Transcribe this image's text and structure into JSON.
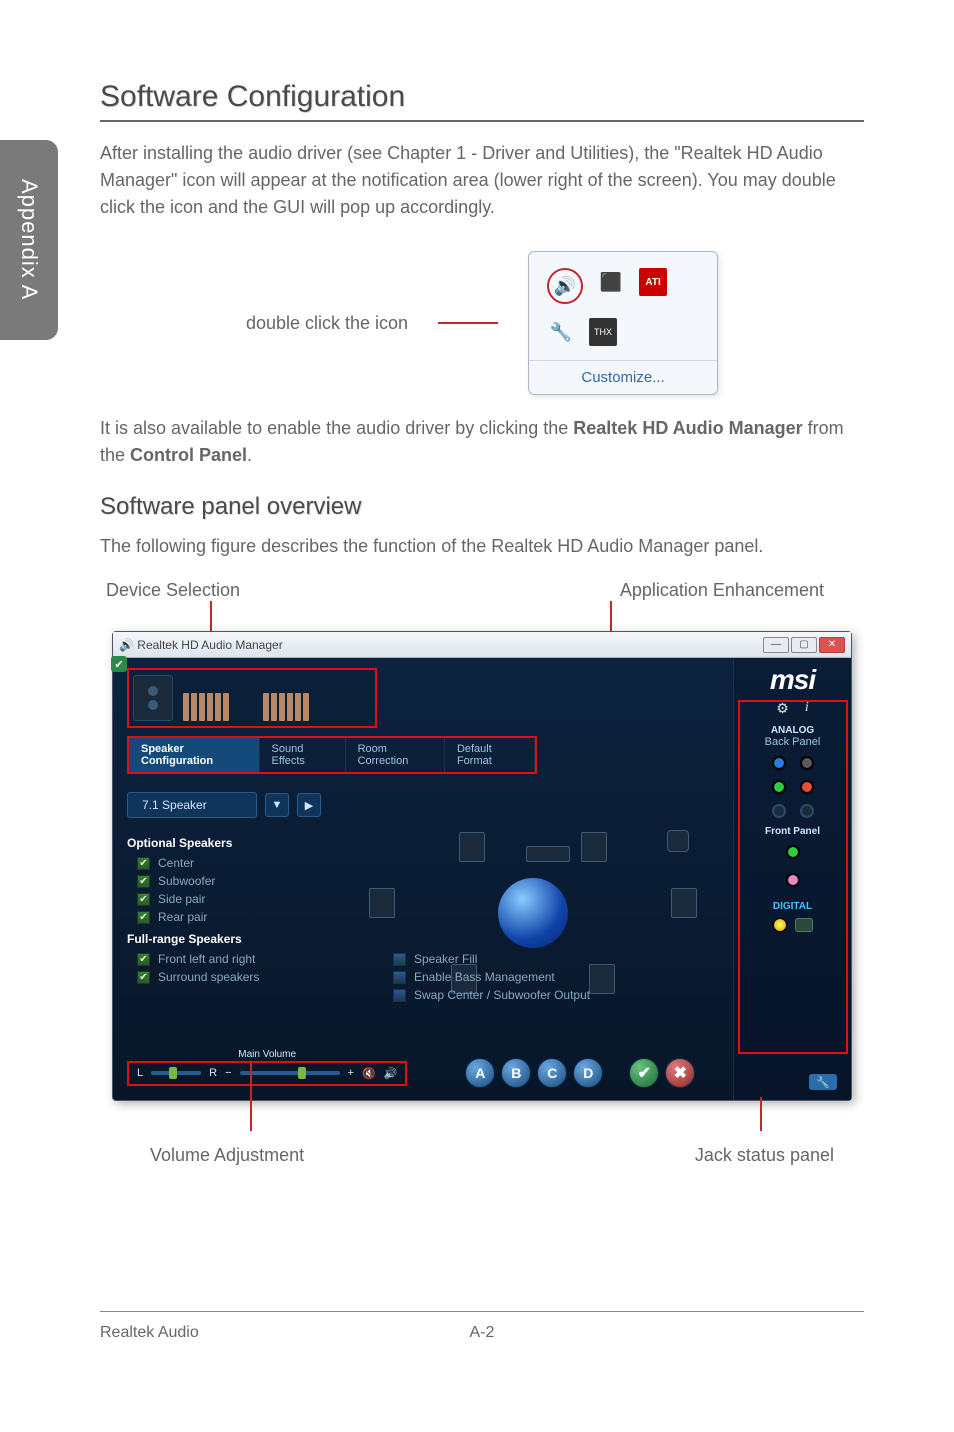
{
  "sideTab": "Appendix A",
  "title": "Software Configuration",
  "intro": "After installing the audio driver (see Chapter 1 - Driver and Utilities), the \"Realtek HD Audio Manager\" icon will appear at the notification area (lower right of the screen). You may double click the icon and the GUI will pop up accordingly.",
  "trayLabel": "double click the icon",
  "trayCustomize": "Customize...",
  "enableLine1": "It is also available to enable the audio driver by clicking the ",
  "enableBold1": "Realtek HD Audio Manager",
  "enableMid": " from the ",
  "enableBold2": "Control Panel",
  "enableEnd": ".",
  "subhead": "Software panel overview",
  "panelDesc": "The following figure describes the function of the Realtek HD Audio Manager panel.",
  "callouts": {
    "deviceSelection": "Device Selection",
    "appEnhancement": "Application Enhancement",
    "volumeAdjustment": "Volume Adjustment",
    "jackStatus": "Jack status panel"
  },
  "app": {
    "title": "Realtek HD Audio Manager",
    "logo": "msi",
    "tabs": {
      "speakerConfig": "Speaker Configuration",
      "soundEffects": "Sound Effects",
      "roomCorrection": "Room Correction",
      "defaultFormat": "Default Format"
    },
    "speakerSelect": "7.1 Speaker",
    "optSpeakersHead": "Optional Speakers",
    "optSpeakers": {
      "center": "Center",
      "subwoofer": "Subwoofer",
      "sidePair": "Side pair",
      "rearPair": "Rear pair"
    },
    "fullRangeHead": "Full-range Speakers",
    "fullRange": {
      "front": "Front left and right",
      "surround": "Surround speakers"
    },
    "extraOpts": {
      "speakerFill": "Speaker Fill",
      "bass": "Enable Bass Management",
      "swap": "Swap Center / Subwoofer Output"
    },
    "mainVolume": "Main Volume",
    "balL": "L",
    "balR": "R",
    "side": {
      "analog": "ANALOG",
      "backPanel": "Back Panel",
      "frontPanel": "Front Panel",
      "digital": "DIGITAL"
    },
    "pills": {
      "a": "A",
      "b": "B",
      "c": "C",
      "d": "D"
    }
  },
  "footer": {
    "left": "Realtek Audio",
    "center": "A-2"
  }
}
